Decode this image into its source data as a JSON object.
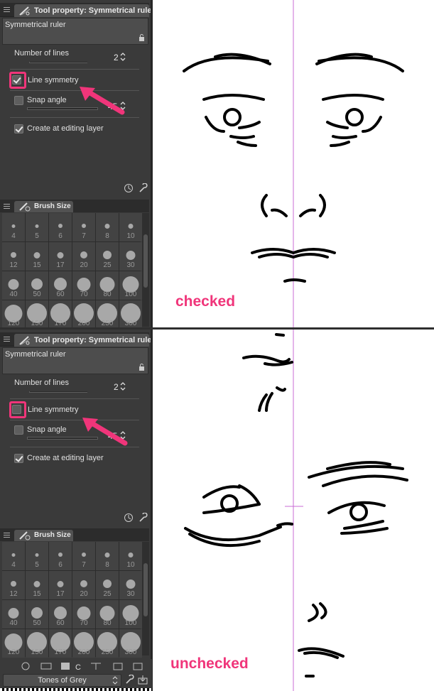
{
  "panels": [
    {
      "tab_title": "Tool property: Symmetrical ruler",
      "property_name": "Symmetrical ruler",
      "number_of_lines_label": "Number of lines",
      "number_of_lines_value": "2",
      "line_symmetry_label": "Line symmetry",
      "line_symmetry_checked": true,
      "snap_angle_label": "Snap angle",
      "snap_angle_value": "45",
      "create_at_editing_layer_label": "Create at editing layer",
      "brush_size_tab": "Brush Size",
      "caption": "checked"
    },
    {
      "tab_title": "Tool property: Symmetrical ruler",
      "property_name": "Symmetrical ruler",
      "number_of_lines_label": "Number of lines",
      "number_of_lines_value": "2",
      "line_symmetry_label": "Line symmetry",
      "line_symmetry_checked": false,
      "snap_angle_label": "Snap angle",
      "snap_angle_value": "45",
      "create_at_editing_layer_label": "Create at editing layer",
      "brush_size_tab": "Brush Size",
      "caption": "unchecked"
    }
  ],
  "brush_sizes": [
    "4",
    "5",
    "6",
    "7",
    "8",
    "10",
    "12",
    "15",
    "17",
    "20",
    "25",
    "30",
    "40",
    "50",
    "60",
    "70",
    "80",
    "100",
    "120",
    "150",
    "170",
    "200",
    "250",
    "300"
  ],
  "bottom_dropdown": "Tones of Grey",
  "colors": {
    "highlight": "#f0357a",
    "ruler_line": "#c86bd6"
  }
}
